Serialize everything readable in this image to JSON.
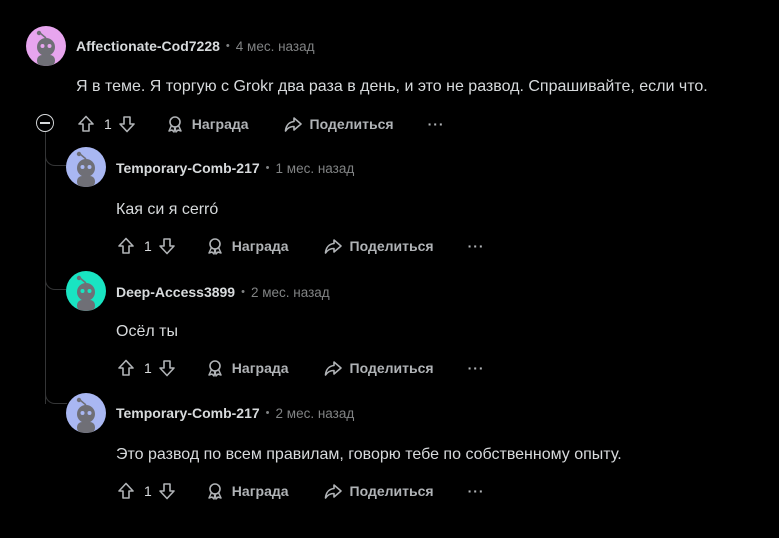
{
  "comments": [
    {
      "author": "Affectionate-Cod7228",
      "separator": "•",
      "time": "4 мес. назад",
      "text": "Я в теме. Я торгую с Grokr два раза в день, и это не развод. Спрашивайте, если что.",
      "score": "1",
      "award_label": "Награда",
      "share_label": "Поделиться",
      "more_label": "···",
      "avatar_color": "#e7a5ee"
    },
    {
      "author": "Temporary-Comb-217",
      "separator": "•",
      "time": "1 мес. назад",
      "text": "Кая си я cerró",
      "score": "1",
      "award_label": "Награда",
      "share_label": "Поделиться",
      "more_label": "···",
      "avatar_color": "#a9b7f2"
    },
    {
      "author": "Deep-Access3899",
      "separator": "•",
      "time": "2 мес. назад",
      "text": "Осёл ты",
      "score": "1",
      "award_label": "Награда",
      "share_label": "Поделиться",
      "more_label": "···",
      "avatar_color": "#19e4c2"
    },
    {
      "author": "Temporary-Comb-217",
      "separator": "•",
      "time": "2 мес. назад",
      "text": "Это развод по всем правилам, говорю тебе по собственному опыту.",
      "score": "1",
      "award_label": "Награда",
      "share_label": "Поделиться",
      "more_label": "···",
      "avatar_color": "#a9b7f2"
    }
  ],
  "colors": {
    "background": "#000000",
    "text": "#d7dadc",
    "muted": "#818384",
    "thread_line": "#343536"
  }
}
